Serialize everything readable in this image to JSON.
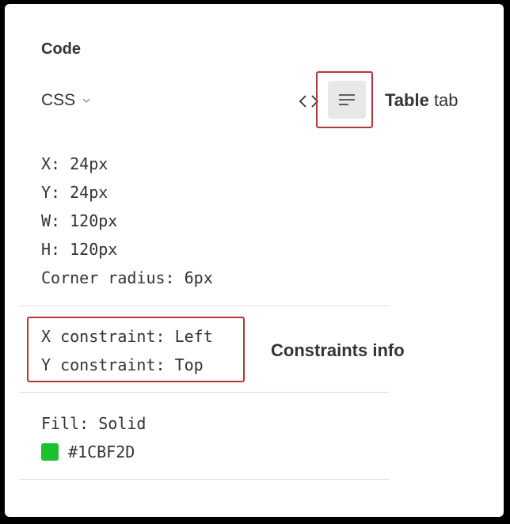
{
  "panel": {
    "section_title": "Code",
    "language": "CSS"
  },
  "annotations": {
    "table_tab_bold": "Table",
    "table_tab_rest": " tab",
    "constraints_info": "Constraints info"
  },
  "properties": {
    "x": "X: 24px",
    "y": "Y: 24px",
    "w": "W: 120px",
    "h": "H: 120px",
    "corner_radius": "Corner radius: 6px"
  },
  "constraints": {
    "x": "X constraint: Left",
    "y": "Y constraint: Top"
  },
  "fill": {
    "type": "Fill: Solid",
    "color_label": "#1CBF2D",
    "color": "#1CBF2D"
  },
  "colors": {
    "highlight": "#b3363c",
    "tab_bg": "#e8e8e8"
  },
  "icons": {
    "code_tab": "code-brackets-icon",
    "table_tab": "table-lines-icon",
    "dropdown": "chevron-down-icon"
  }
}
